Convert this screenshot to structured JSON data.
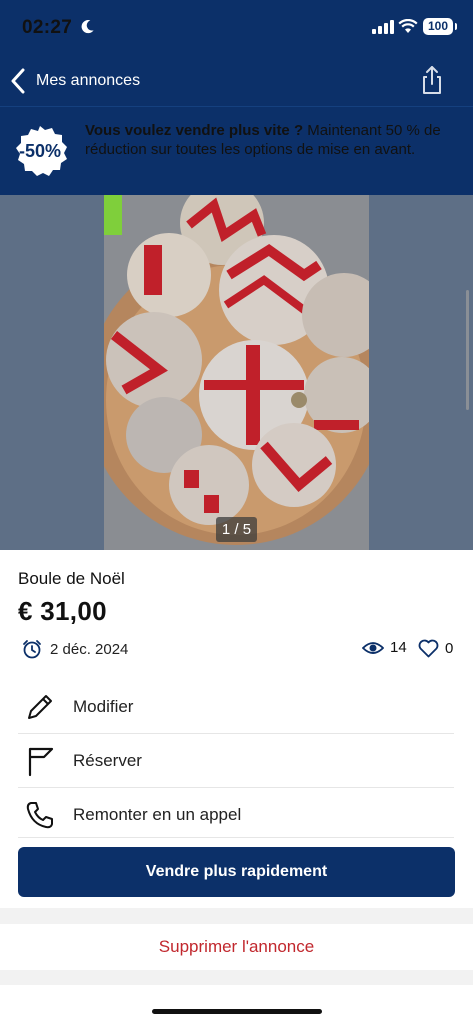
{
  "status": {
    "time": "02:27",
    "battery": "100"
  },
  "nav": {
    "back_label": "Mes annonces"
  },
  "promo": {
    "badge": "-50%",
    "bold": "Vous voulez vendre plus vite ?",
    "rest": " Maintenant 50 % de réduction sur toutes les options de mise en avant."
  },
  "gallery": {
    "counter": "1 / 5"
  },
  "listing": {
    "title": "Boule de Noël",
    "price": "€ 31,00",
    "date": "2 déc. 2024",
    "views": "14",
    "likes": "0"
  },
  "actions": [
    {
      "label": "Modifier",
      "icon": "pencil-icon"
    },
    {
      "label": "Réserver",
      "icon": "flag-icon"
    },
    {
      "label": "Remonter en un appel",
      "icon": "phone-icon"
    }
  ],
  "buttons": {
    "sell_faster": "Vendre plus rapidement",
    "delete": "Supprimer l'annonce"
  },
  "colors": {
    "brand": "#0c3069",
    "danger": "#c1272d",
    "gallery_bg": "#5e6f86"
  }
}
